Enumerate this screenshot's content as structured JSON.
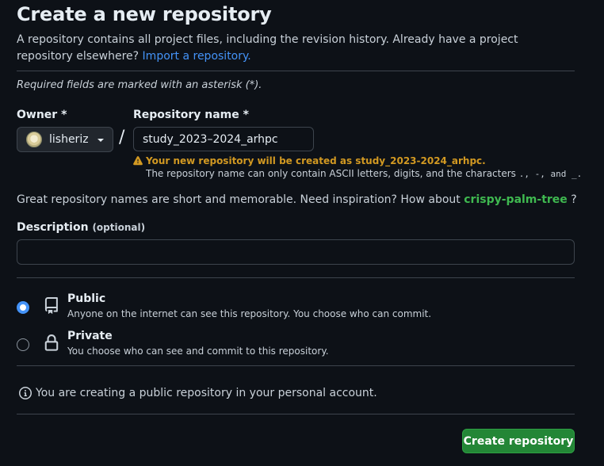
{
  "page": {
    "title": "Create a new repository",
    "intro_text": "A repository contains all project files, including the revision history. Already have a project repository elsewhere?",
    "import_link": "Import a repository.",
    "required_note": "Required fields are marked with an asterisk (*)."
  },
  "owner": {
    "label": "Owner *",
    "name": "lisheriz"
  },
  "separator": "/",
  "repo_name": {
    "label": "Repository name *",
    "value": "study_2023–2024_arhpc",
    "warning": "Your new repository will be created as study_2023-2024_arhpc.",
    "hint_prefix": "The repository name can only contain ASCII letters, digits, and the characters",
    "hint_chars": ".,  -, and _."
  },
  "suggestion": {
    "prefix": "Great repository names are short and memorable. Need inspiration? How about",
    "name": "crispy-palm-tree",
    "suffix": "?"
  },
  "description": {
    "label": "Description",
    "optional": "(optional)",
    "value": ""
  },
  "visibility": {
    "public": {
      "title": "Public",
      "desc": "Anyone on the internet can see this repository. You choose who can commit.",
      "selected": true,
      "icon": "repo-icon"
    },
    "private": {
      "title": "Private",
      "desc": "You choose who can see and commit to this repository.",
      "selected": false,
      "icon": "lock-icon"
    }
  },
  "info_text": "You are creating a public repository in your personal account.",
  "create_button": "Create repository",
  "colors": {
    "background": "#0d1117",
    "link": "#4493f8",
    "success": "#3fb950",
    "warning": "#d29922",
    "button": "#238636"
  }
}
